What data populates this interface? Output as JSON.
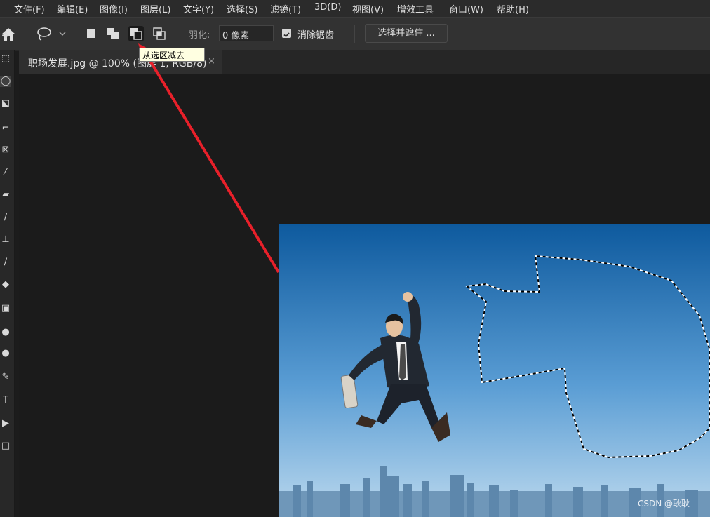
{
  "menu": [
    "文件(F)",
    "编辑(E)",
    "图像(I)",
    "图层(L)",
    "文字(Y)",
    "选择(S)",
    "滤镜(T)",
    "3D(D)",
    "视图(V)",
    "增效工具",
    "窗口(W)",
    "帮助(H)"
  ],
  "options": {
    "feather_label": "羽化:",
    "feather_value": "0 像素",
    "antialias_label": "消除锯齿",
    "antialias_checked": true,
    "select_mask_label": "选择并遮住 ...",
    "selection_modes": [
      "new-selection-icon",
      "add-to-selection-icon",
      "subtract-from-selection-icon",
      "intersect-selection-icon"
    ],
    "active_mode": "subtract-from-selection-icon"
  },
  "tooltip": "从选区减去",
  "document": {
    "tab_title": "职场发展.jpg @ 100% (图层 1, RGB/8)",
    "close_glyph": "×"
  },
  "tools": [
    "move-tool-icon",
    "marquee-tool-icon",
    "lasso-tool-icon",
    "object-select-tool-icon",
    "crop-tool-icon",
    "frame-tool-icon",
    "eyedropper-tool-icon",
    "healing-brush-icon",
    "brush-tool-icon",
    "clone-stamp-icon",
    "history-brush-icon",
    "eraser-tool-icon",
    "gradient-tool-icon",
    "blur-tool-icon",
    "dodge-tool-icon",
    "pen-tool-icon",
    "type-tool-icon",
    "path-select-tool-icon",
    "rectangle-tool-icon"
  ],
  "active_tool": "lasso-tool-icon",
  "watermark": "CSDN @耿耿",
  "colors": {
    "annotation_arrow": "#e8202a",
    "sky_top": "#0e5a9e",
    "sky_bottom": "#bcd9ee"
  }
}
